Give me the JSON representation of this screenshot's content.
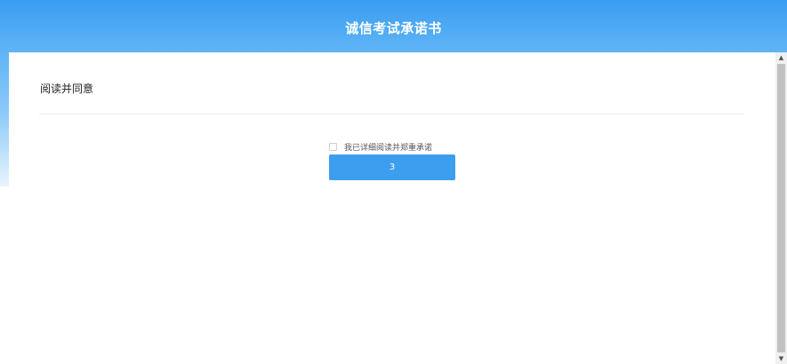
{
  "header": {
    "title": "诚信考试承诺书"
  },
  "content": {
    "section_title": "阅读并同意",
    "agree_checkbox_label": "我已详细阅读并郑重承诺",
    "confirm_button_label": "3"
  },
  "scrollbar": {
    "up_icon": "▲",
    "down_icon": "▼"
  },
  "colors": {
    "header_blue": "#3a9df0",
    "button_blue": "#3d9ef0"
  }
}
